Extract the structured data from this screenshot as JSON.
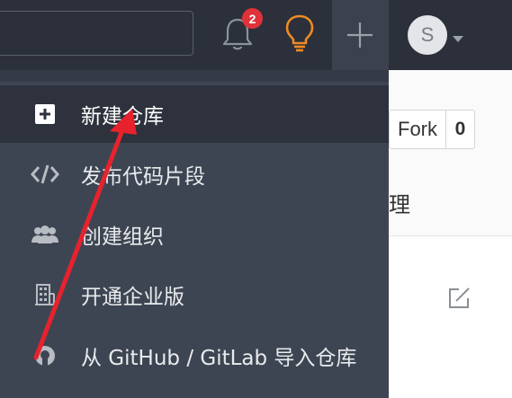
{
  "navbar": {
    "notification_count": "2",
    "user_initial": "S"
  },
  "repo": {
    "fork_label": "Fork",
    "fork_count": "0",
    "manage_partial": "理"
  },
  "create_menu": {
    "items": [
      {
        "label": "新建仓库",
        "icon": "plus-square-icon",
        "active": true
      },
      {
        "label": "发布代码片段",
        "icon": "code-icon",
        "active": false
      },
      {
        "label": "创建组织",
        "icon": "users-icon",
        "active": false
      },
      {
        "label": "开通企业版",
        "icon": "building-icon",
        "active": false
      },
      {
        "label": "从 GitHub / GitLab 导入仓库",
        "icon": "github-icon",
        "active": false
      }
    ]
  },
  "colors": {
    "navbar": "#2b303a",
    "dropdown": "#3e4552",
    "active_item": "#2d323c",
    "badge": "#e0323a",
    "bulb": "#f08a24",
    "annotation_arrow": "#e8222c"
  }
}
